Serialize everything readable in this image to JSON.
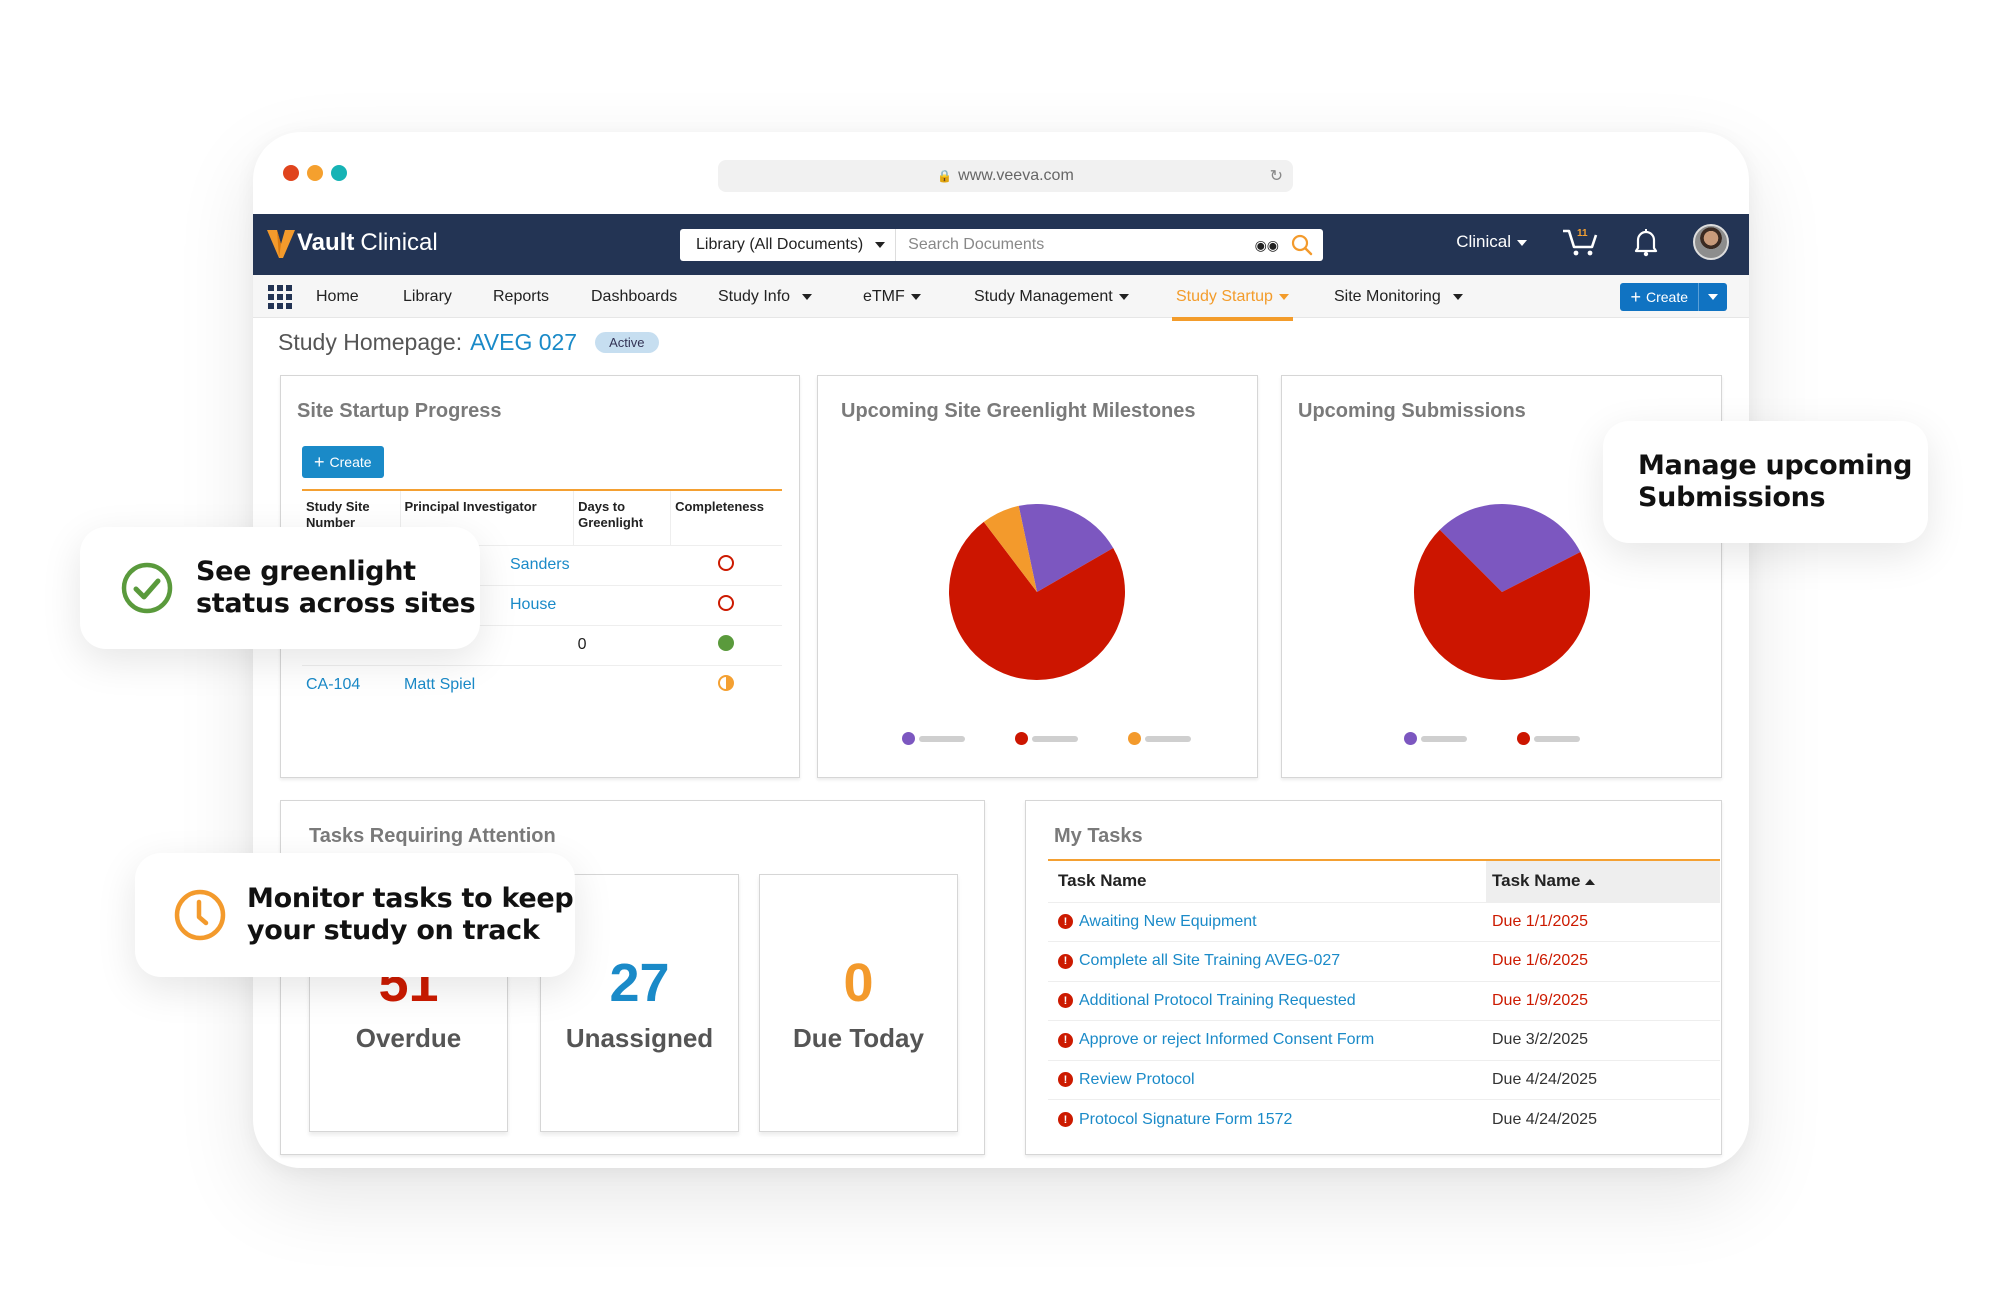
{
  "browser": {
    "url": "www.veeva.com",
    "dot_colors": [
      "#e0441d",
      "#f5a02e",
      "#16b3b5"
    ]
  },
  "header": {
    "app_name_bold": "Vault",
    "app_name_rest": "Clinical",
    "search_scope": "Library (All Documents)",
    "search_placeholder": "Search Documents",
    "app_switcher": "Clinical",
    "cart_count": "11"
  },
  "nav": {
    "items": [
      {
        "label": "Home",
        "dropdown": false
      },
      {
        "label": "Library",
        "dropdown": false
      },
      {
        "label": "Reports",
        "dropdown": false
      },
      {
        "label": "Dashboards",
        "dropdown": false
      },
      {
        "label": "Study Info",
        "dropdown": true
      },
      {
        "label": "eTMF",
        "dropdown": true
      },
      {
        "label": "Study Management",
        "dropdown": true
      },
      {
        "label": "Study Startup",
        "dropdown": true,
        "active": true
      },
      {
        "label": "Site Monitoring",
        "dropdown": true
      }
    ],
    "create_label": "Create"
  },
  "page": {
    "title_prefix": "Study Homepage:",
    "study": "AVEG 027",
    "status": "Active"
  },
  "site_startup": {
    "title": "Site Startup Progress",
    "create_label": "Create",
    "columns": [
      "Study Site Number",
      "Principal Investigator",
      "Days to Greenlight",
      "Completeness"
    ],
    "rows": [
      {
        "site": "",
        "investigator": "Sanders",
        "days": "",
        "status": "not-started"
      },
      {
        "site": "",
        "investigator": "House",
        "days": "",
        "status": "not-started"
      },
      {
        "site": "",
        "investigator": "",
        "days": "0",
        "status": "complete"
      },
      {
        "site": "CA-104",
        "investigator": "Matt Spiel",
        "days": "",
        "status": "in-progress"
      }
    ]
  },
  "greenlight": {
    "title": "Upcoming Site Greenlight Milestones"
  },
  "submissions": {
    "title": "Upcoming Submissions"
  },
  "chart_data": [
    {
      "type": "pie",
      "title": "Upcoming Site Greenlight Milestones",
      "legend": "bottom",
      "slices": [
        {
          "label": "",
          "value": 20,
          "color": "#7c57c0"
        },
        {
          "label": "",
          "value": 73,
          "color": "#cc1500"
        },
        {
          "label": "",
          "value": 7,
          "color": "#f39a2c"
        }
      ]
    },
    {
      "type": "pie",
      "title": "Upcoming Submissions",
      "legend": "bottom",
      "slices": [
        {
          "label": "",
          "value": 30,
          "color": "#7c57c0"
        },
        {
          "label": "",
          "value": 70,
          "color": "#cc1500"
        }
      ]
    }
  ],
  "tasks_attention": {
    "title": "Tasks Requiring Attention",
    "tiles": [
      {
        "value": "51",
        "label": "Overdue",
        "color": "#cc1a00"
      },
      {
        "value": "27",
        "label": "Unassigned",
        "color": "#1a8ac8"
      },
      {
        "value": "0",
        "label": "Due Today",
        "color": "#f39a2c"
      }
    ]
  },
  "my_tasks": {
    "title": "My Tasks",
    "columns": [
      "Task Name",
      "Task Name"
    ],
    "rows": [
      {
        "name": "Awaiting New Equipment",
        "due": "Due 1/1/2025",
        "overdue": true
      },
      {
        "name": "Complete all Site Training AVEG-027",
        "due": "Due 1/6/2025",
        "overdue": true
      },
      {
        "name": "Additional Protocol Training Requested",
        "due": "Due 1/9/2025",
        "overdue": true
      },
      {
        "name": "Approve or reject Informed Consent Form",
        "due": "Due 3/2/2025",
        "overdue": false
      },
      {
        "name": "Review Protocol",
        "due": "Due 4/24/2025",
        "overdue": false
      },
      {
        "name": "Protocol Signature Form 1572",
        "due": "Due 4/24/2025",
        "overdue": false
      }
    ]
  },
  "callouts": {
    "greenlight": "See greenlight status across sites",
    "greenlight_l1": "See greenlight",
    "greenlight_l2": "status across sites",
    "submissions_l1": "Manage upcoming",
    "submissions_l2": "Submissions",
    "tasks_l1": "Monitor tasks to keep",
    "tasks_l2": "your study on track"
  }
}
